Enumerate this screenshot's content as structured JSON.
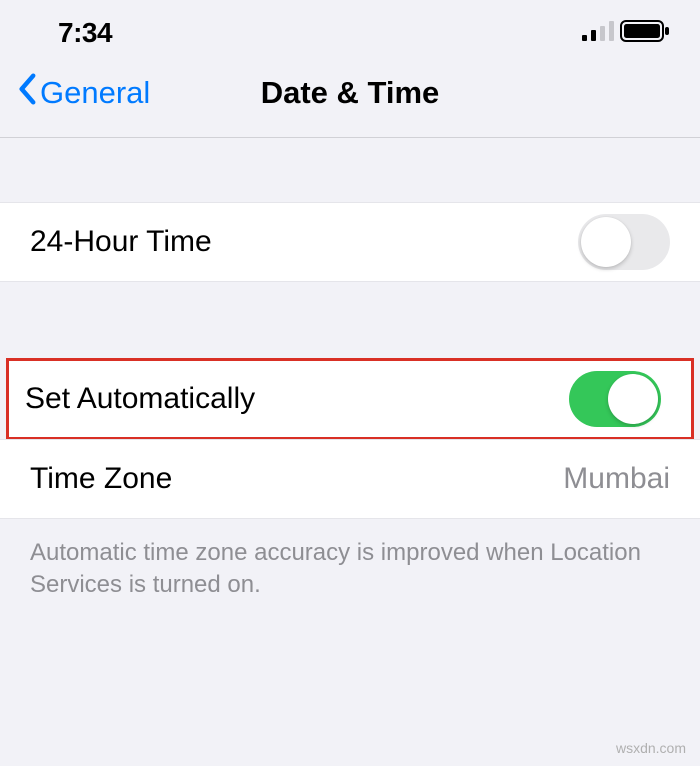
{
  "status": {
    "time": "7:34"
  },
  "nav": {
    "back_label": "General",
    "title": "Date & Time"
  },
  "rows": {
    "twenty_four_hour": {
      "label": "24-Hour Time",
      "enabled": false
    },
    "set_automatically": {
      "label": "Set Automatically",
      "enabled": true
    },
    "time_zone": {
      "label": "Time Zone",
      "value": "Mumbai"
    }
  },
  "footer": "Automatic time zone accuracy is improved when Location Services is turned on.",
  "watermark": "wsxdn.com"
}
